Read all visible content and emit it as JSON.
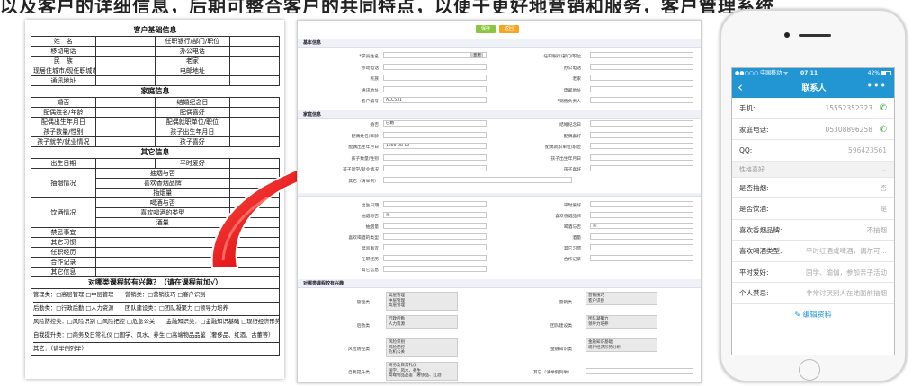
{
  "banner": "以及客户的详细信息，后期可整合客户的共同特点，以便于更好地营销和服务，客户管理系统",
  "paper": {
    "basic_title": "客户基础信息",
    "basic_rows": [
      [
        "姓　名",
        "",
        "任职银行/部门/职位",
        ""
      ],
      [
        "移动电话",
        "",
        "办公电话",
        ""
      ],
      [
        "民　族",
        "",
        "老家",
        ""
      ],
      [
        "现居住城市/现任职城市",
        "",
        "电邮地址",
        ""
      ],
      [
        "通讯地址",
        "",
        "",
        ""
      ]
    ],
    "family_title": "家庭信息",
    "family_rows": [
      [
        "婚否",
        "",
        "结婚纪念日",
        ""
      ],
      [
        "配偶姓名/年龄",
        "",
        "配偶喜好",
        ""
      ],
      [
        "配偶出生年月日",
        "",
        "配偶就职单位/职位",
        ""
      ],
      [
        "孩子数量/性别",
        "",
        "孩子出生年月日",
        ""
      ],
      [
        "孩子就学/就业情况",
        "",
        "孩子喜好",
        ""
      ]
    ],
    "other_title": "其它信息",
    "other_top": [
      "出生日期",
      "",
      "平时爱好",
      ""
    ],
    "smoke_label": "抽烟情况",
    "smoke_items": [
      "抽烟与否",
      "喜欢香烟品牌",
      "抽烟量"
    ],
    "drink_label": "饮酒情况",
    "drink_items": [
      "喝酒与否",
      "喜欢喝酒的类型",
      "酒量"
    ],
    "other_rows": [
      "禁忌事宜",
      "其它习惯",
      "任职经历",
      "合作记录",
      "其它信息"
    ],
    "course_title": "对哪类课程较有兴趣？（请在课程前加√）",
    "course_lines": [
      "管理类：□高层管理 □中层管理　　营销类：□营销技巧 □客户识别",
      "后勤类：□行政后勤 □人力资源　　团队建设类：□团队凝聚力 □领导力培养",
      "风险防控类：□风险识别 □风险把控 □危急公关　　金融知识类：□金融知识基础 □现行经济形势",
      "自我提升类：□商务及日常礼仪 □国学、风水、养生 □高端物品品鉴（奢侈品、红酒、古董等）",
      "其它：（请举例列举）"
    ]
  },
  "web": {
    "save_label": "保存",
    "cancel_label": "返回",
    "sec_basic": "基本信息",
    "sec_family": "家庭信息",
    "sec_course": "对哪类课程较有兴趣",
    "left_labels": [
      "*学员姓名",
      "移动电话",
      "民族",
      "通讯地址",
      "客户编号"
    ],
    "right_labels": [
      "任职银行/部门/职位",
      "办公电话",
      "老家",
      "电邮地址",
      "*销售负责人"
    ],
    "name_btn": "查重",
    "customer_no": "ACC531",
    "fam_left": [
      "婚否",
      "配偶姓名/年龄",
      "配偶出生年月日",
      "孩子数量/性别",
      "孩子就学/就业情况",
      "其它（请举例）"
    ],
    "fam_right": [
      "结婚纪念日",
      "配偶喜好",
      "配偶就职单位/职位",
      "孩子出生年月日",
      "孩子喜好"
    ],
    "married": "已婚",
    "spouse_birth": "1980-08-10",
    "oth_left": [
      "出生日期",
      "抽烟与否",
      "抽烟量",
      "喜欢喝酒的类型",
      "禁忌事宜",
      "任职经历",
      "其它信息"
    ],
    "oth_right": [
      "平时爱好",
      "喜欢香烟品牌",
      "喝酒与否",
      "酒量",
      "其它习惯",
      "合作记录"
    ],
    "smoke_val": "是",
    "drink_val": "是",
    "course_left": [
      "管理类",
      "后勤类",
      "风险防控类",
      "自我提升类"
    ],
    "course_right": [
      "营销类",
      "团队建设类",
      "金融知识类",
      "其它（请举例列举）"
    ],
    "course_left_opts": [
      "高层管理\n中层管理\n高层管理",
      "行政后勤\n人力资源",
      "风险识别\n风险把控\n危机公关",
      "商务及日常礼仪\n国学、风水、养生\n高端物品品鉴（奢侈品、红酒"
    ],
    "course_right_opts": [
      "营销技巧\n客户识别",
      "团队凝聚力\n领导力培养",
      "金融知识基础\n现行经济形势分析",
      ""
    ]
  },
  "phone": {
    "carrier": "●●○○○ 中国移动 ᯤ",
    "time": "07:11",
    "battery": "42%",
    "title": "联系人",
    "back_icon": "chevron-left-icon",
    "more_icon": "more-dots-icon",
    "rows_top": [
      [
        "手机:",
        "15552352323"
      ],
      [
        "家庭电话:",
        "05308896258"
      ],
      [
        "QQ:",
        "596423561"
      ]
    ],
    "section": "性格喜好",
    "rows_bottom": [
      [
        "是否抽烟:",
        "否"
      ],
      [
        "是否饮酒:",
        "是"
      ],
      [
        "喜欢香烟品牌:",
        "不抽烟"
      ],
      [
        "喜欢喝酒类型:",
        "平时红酒或啤酒，偶尔可…"
      ],
      [
        "平时爱好:",
        "国学、瑜伽，参加亲子活动"
      ],
      [
        "个人禁忌:",
        "非常讨厌别人在她面前抽烟"
      ]
    ],
    "edit_label": "编辑资料",
    "phone_color": "#4caf50",
    "accent": "#2196d3"
  }
}
